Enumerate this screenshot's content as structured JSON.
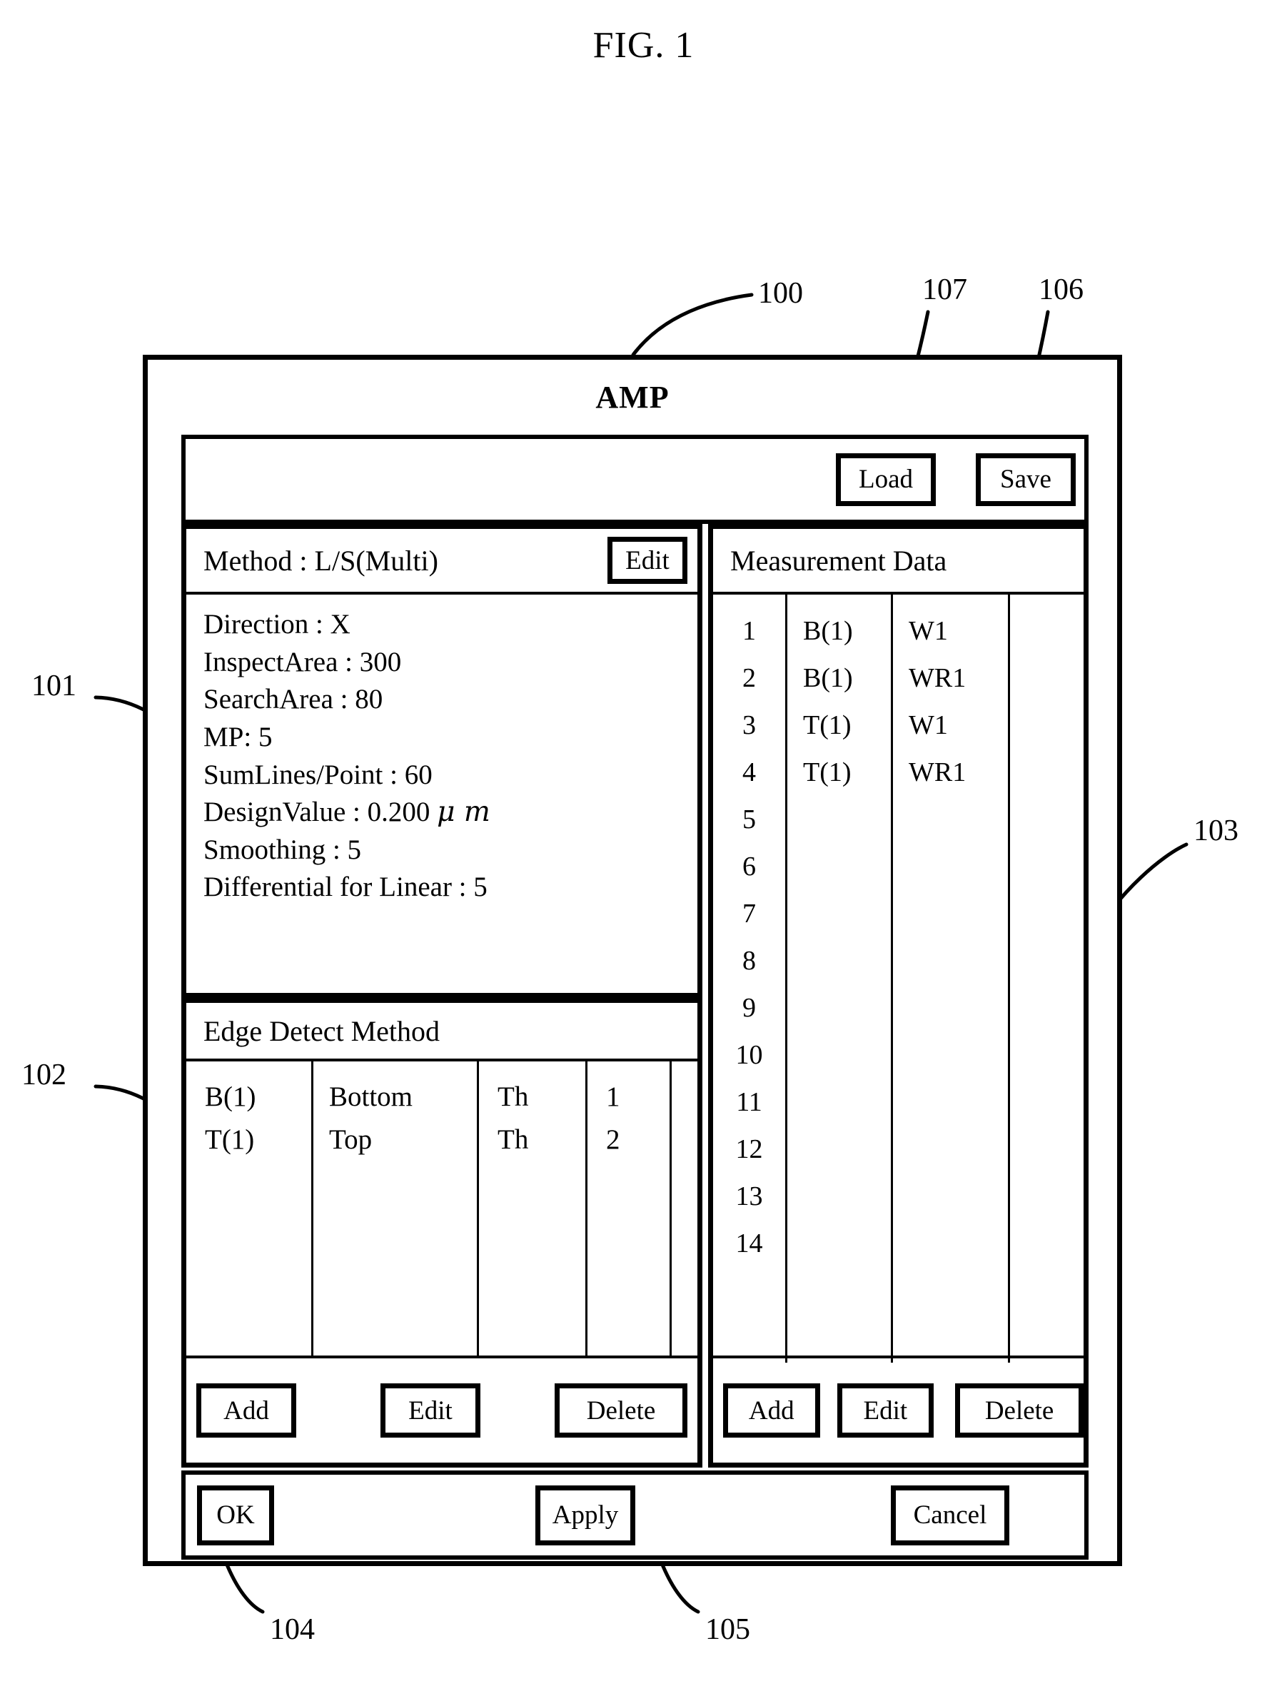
{
  "figure": {
    "caption": "FIG. 1",
    "reference_numerals": [
      {
        "id": "100",
        "label": "100"
      },
      {
        "id": "101",
        "label": "101"
      },
      {
        "id": "102",
        "label": "102"
      },
      {
        "id": "103",
        "label": "103"
      },
      {
        "id": "104",
        "label": "104"
      },
      {
        "id": "105",
        "label": "105"
      },
      {
        "id": "106",
        "label": "106"
      },
      {
        "id": "107",
        "label": "107"
      }
    ]
  },
  "dialog": {
    "title": "AMP",
    "toolbar": {
      "load_label": "Load",
      "save_label": "Save"
    },
    "method_panel": {
      "header_label": "Method : L/S(Multi)",
      "edit_label": "Edit",
      "parameters": [
        "Direction : X",
        "InspectArea : 300",
        "SearchArea : 80",
        "MP: 5",
        "SumLines/Point : 60",
        "Smoothing : 5",
        "Differential for Linear : 5"
      ],
      "design_value_prefix": "DesignValue : 0.200 ",
      "design_value_unit": "μ m"
    },
    "edge_detect_panel": {
      "header_label": "Edge Detect Method",
      "columns": [
        {
          "values": [
            "B(1)",
            "T(1)"
          ]
        },
        {
          "values": [
            "Bottom",
            "Top"
          ]
        },
        {
          "values": [
            "Th",
            "Th"
          ]
        },
        {
          "values": [
            "1",
            "2"
          ]
        },
        {
          "values": []
        }
      ],
      "buttons": {
        "add_label": "Add",
        "edit_label": "Edit",
        "delete_label": "Delete"
      }
    },
    "measurement_panel": {
      "header_label": "Measurement Data",
      "row_indices": [
        "1",
        "2",
        "3",
        "4",
        "5",
        "6",
        "7",
        "8",
        "9",
        "10",
        "11",
        "12",
        "13",
        "14"
      ],
      "col_a": [
        "B(1)",
        "B(1)",
        "T(1)",
        "T(1)"
      ],
      "col_b": [
        "W1",
        "WR1",
        "W1",
        "WR1"
      ],
      "buttons": {
        "add_label": "Add",
        "edit_label": "Edit",
        "delete_label": "Delete"
      }
    },
    "footer": {
      "ok_label": "OK",
      "apply_label": "Apply",
      "cancel_label": "Cancel"
    }
  }
}
